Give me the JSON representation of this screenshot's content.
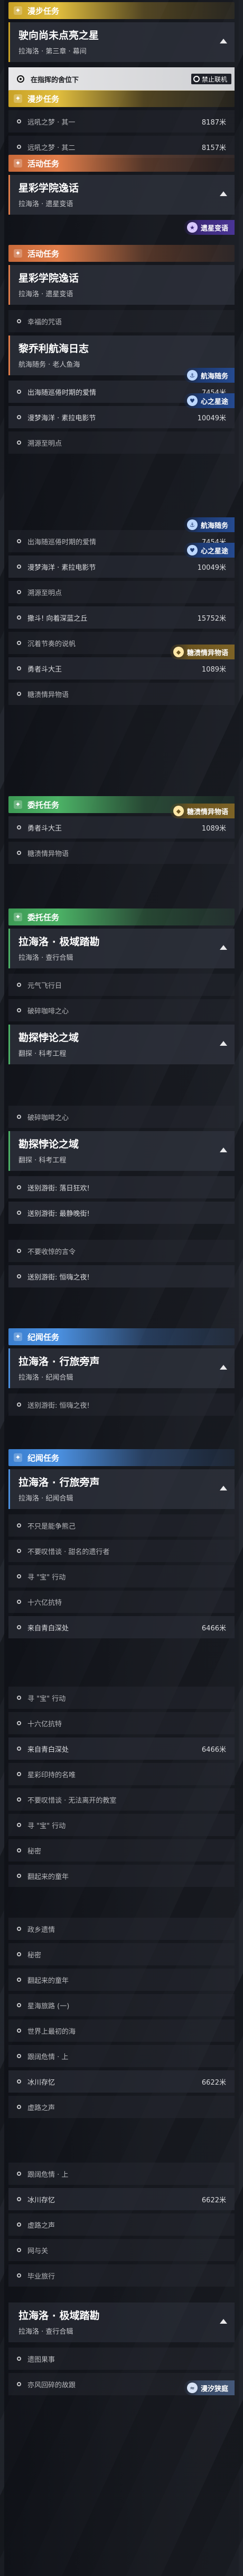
{
  "sections": {
    "s1_header": "漫步任务",
    "s1_card_title": "驶向尚未点亮之星",
    "s1_card_sub": "拉海洛 · 第三章 · 幕间",
    "s1_obj1": "在指挥的舍位下",
    "s1_track": "禁止联机",
    "s2_header": "漫步任务",
    "s2_obj1": "远吼之梦 · 其一",
    "s2_obj1_dist": "8187米",
    "s2_obj2": "远吼之梦 · 其二",
    "s2_obj2_dist": "8157米",
    "s3_header": "活动任务",
    "s3_card_title": "星彩学院逸话",
    "s3_card_sub": "拉海洛 · 遗星变语",
    "s3_badge": "遗星变语",
    "s4_header": "活动任务",
    "s4_card_title": "星彩学院逸话",
    "s4_card_sub": "拉海洛 · 遗星变语",
    "s4_obj1": "幸福的咒语",
    "s4_card2_title": "黎乔利航海日志",
    "s4_card2_sub": "航海随务 · 老人鱼海",
    "s4_obj2": "出海随巡倦时期的爱情",
    "s4_obj2_dist": "7454米",
    "s4_badge_a": "航海随务",
    "s4_obj3": "漫梦海洋 · 素拉电影节",
    "s4_obj3_dist": "10049米",
    "s4_badge_b": "心之星途",
    "s4_obj4": "溯源至明点",
    "s5_obj1": "出海随巡倦时期的爱情",
    "s5_obj1_dist": "7454米",
    "s5_badge_a": "航海随务",
    "s5_obj2": "漫梦海洋 · 素拉电影节",
    "s5_obj2_dist": "10049米",
    "s5_badge_b": "心之星途",
    "s5_obj3": "溯源至明点",
    "s5_obj4": "撒斗! 向着深蓝之丘",
    "s5_obj4_dist": "15752米",
    "s5_obj5": "沉着节奏的说帆",
    "s5_obj6": "勇者斗大王",
    "s5_obj6_dist": "1089米",
    "s5_badge_c": "糖渍情异物语",
    "s5_obj7": "糖渍情异物语",
    "s6_header": "委托任务",
    "s6_obj1": "勇者斗大王",
    "s6_obj1_dist": "1089米",
    "s6_badge": "糖渍情异物语",
    "s6_obj2": "糖渍情异物语",
    "s7_header": "委托任务",
    "s7_card_title": "拉海洛 · 极域踏勘",
    "s7_card_sub": "拉海洛 · 查行合辑",
    "s7_obj1": "元气飞行日",
    "s7_obj2": "破碎咖啡之心",
    "s7_card2_title": "勘探悖论之域",
    "s7_card2_sub": "翻探 · 科考工程",
    "s8_obj1": "破碎咖啡之心",
    "s8_card_title": "勘探悖论之域",
    "s8_card_sub": "翻探 · 科考工程",
    "s8_obj2": "送别游街: 落日狂欢!",
    "s8_obj3": "送别游街: 最静晚街!",
    "s8_obj4": "不要收惊的言令",
    "s8_obj5": "送别游街: 恒嗨之夜!",
    "s9_header": "纪闻任务",
    "s9_card_title": "拉海洛 · 行旅旁声",
    "s9_card_sub": "拉海洛 · 纪闻合辑",
    "s9_obj1": "送别游街: 恒嗨之夜!",
    "s10_header": "纪闻任务",
    "s10_card_title": "拉海洛 · 行旅旁声",
    "s10_card_sub": "拉海洛 · 纪闻合辑",
    "s10_obj1": "不只是能争熊己",
    "s10_obj2": "不要叹惜谈 · 甜名的遗行者",
    "s10_obj3": "寻 \"宝\" 行动",
    "s10_obj4": "十六亿抗特",
    "s10_obj5": "来自青白深处",
    "s10_obj5_dist": "6466米",
    "s11_obj1": "寻 \"宝\" 行动",
    "s11_obj2": "十六亿抗特",
    "s11_obj3": "来自青白深处",
    "s11_obj3_dist": "6466米",
    "s11_obj4": "星彩印持的名唯",
    "s11_obj5": "不要叹惜谈 · 无法离开的教室",
    "s11_obj6": "寻 \"宝\" 行动",
    "s11_obj7": "秘密",
    "s11_obj8": "翻起来的童年",
    "s12_obj1": "政乡遗情",
    "s12_obj2": "秘密",
    "s12_obj3": "翻起来的童年",
    "s12_obj4": "星海旅路 (一)",
    "s12_obj5": "世界上最初的海",
    "s12_obj6": "跟阔危情 · 上",
    "s12_obj7": "冰川存忆",
    "s12_obj7_dist": "6622米",
    "s12_obj8": "虚路之声",
    "s13_obj1": "跟阔危情 · 上",
    "s13_obj2": "冰川存忆",
    "s13_obj2_dist": "6622米",
    "s13_obj3": "虚路之声",
    "s13_obj4": "网与关",
    "s13_obj5": "毕业旅行",
    "s13_card_title": "拉海洛 · 极域踏勘",
    "s13_card_sub": "拉海洛 · 查行合辑",
    "s13_obj6": "遗图果事",
    "s13_obj7": "亦风回碎的故跟",
    "s13_badge": "漫汐狭庭"
  }
}
